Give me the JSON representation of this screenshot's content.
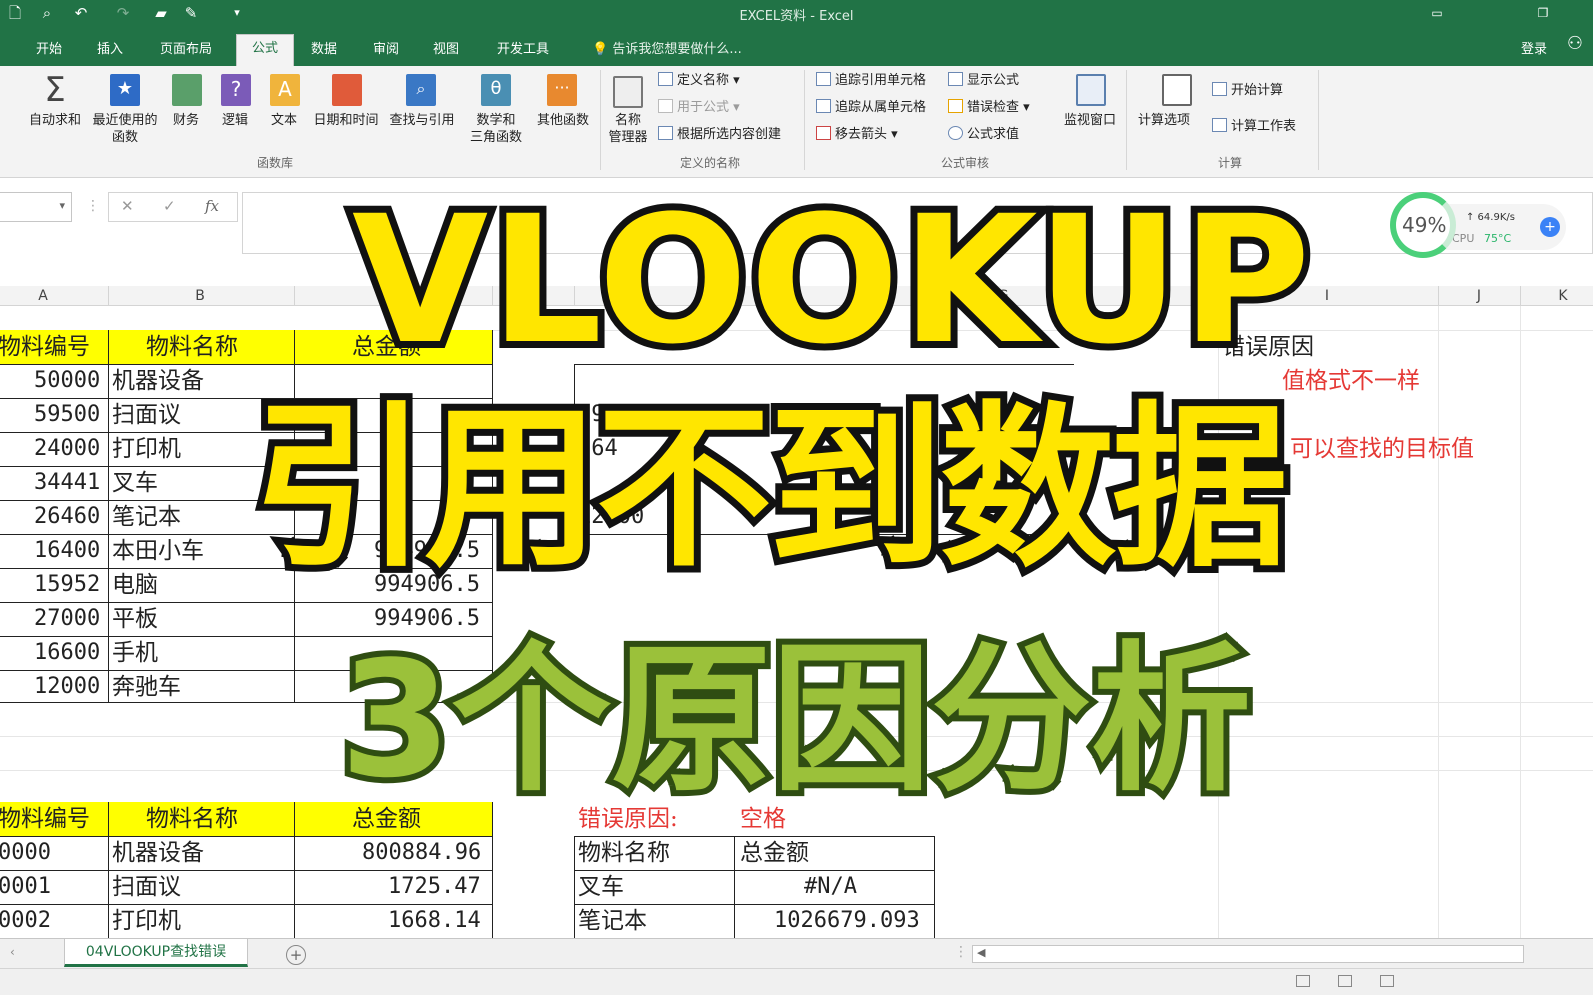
{
  "window": {
    "title": "EXCEL资料 - Excel"
  },
  "tabs": [
    "开始",
    "插入",
    "页面布局",
    "公式",
    "数据",
    "审阅",
    "视图",
    "开发工具"
  ],
  "active_tab": "公式",
  "tell_me": "告诉我您想要做什么...",
  "account": {
    "login": "登录"
  },
  "ribbon": {
    "funclib": {
      "items": [
        "自动求和",
        "最近使用的",
        "函数",
        "财务",
        "逻辑",
        "文本",
        "日期和时间",
        "查找与引用",
        "数学和",
        "三角函数",
        "其他函数"
      ],
      "group": "函数库"
    },
    "names": {
      "manager_line1": "名称",
      "manager_line2": "管理器",
      "define": "定义名称",
      "use_in_formula": "用于公式",
      "create": "根据所选内容创建",
      "group": "定义的名称"
    },
    "audit": {
      "trace_prec": "追踪引用单元格",
      "trace_dep": "追踪从属单元格",
      "remove_arrows": "移去箭头",
      "show_formulas": "显示公式",
      "error_check": "错误检查",
      "evaluate": "公式求值",
      "watch": "监视窗口",
      "group": "公式审核"
    },
    "calc": {
      "options": "计算选项",
      "calc_now": "开始计算",
      "calc_sheet": "计算工作表",
      "group": "计算"
    }
  },
  "formula_bar": {
    "cancel": "✕",
    "enter": "✓",
    "fx": "fx"
  },
  "cpu_widget": {
    "percent": "49%",
    "net": "↑ 64.9K/s",
    "cpu_label": "CPU",
    "temp": "75°C"
  },
  "columns": [
    "A",
    "B",
    "D",
    "G",
    "I",
    "J",
    "K"
  ],
  "table1": {
    "headers": [
      "物料编号",
      "物料名称",
      "总金额"
    ],
    "rows": [
      {
        "id": "50000",
        "name": "机器设备"
      },
      {
        "id": "59500",
        "name": "扫面议"
      },
      {
        "id": "24000",
        "name": "打印机"
      },
      {
        "id": "34441",
        "name": "叉车"
      },
      {
        "id": "26460",
        "name": "笔记本"
      },
      {
        "id": "16400",
        "name": "本田小车",
        "amount": "994906.5"
      },
      {
        "id": "15952",
        "name": "电脑",
        "amount": "994906.5"
      },
      {
        "id": "27000",
        "name": "平板",
        "amount": "994906.5"
      },
      {
        "id": "16600",
        "name": "手机"
      },
      {
        "id": "12000",
        "name": "奔驰车"
      }
    ]
  },
  "lookup1": {
    "partial": [
      "59500",
      "264",
      "12000"
    ]
  },
  "right_notes": {
    "header": "错误原因",
    "note1": "值格式不一样",
    "note2": "可以查找的目标值"
  },
  "table2": {
    "headers": [
      "物料编号",
      "物料名称",
      "总金额"
    ],
    "rows": [
      {
        "id": "0000",
        "name": "机器设备",
        "amount": "800884.96"
      },
      {
        "id": "0001",
        "name": "扫面议",
        "amount": "1725.47"
      },
      {
        "id": "0002",
        "name": "打印机",
        "amount": "1668.14"
      }
    ]
  },
  "lookup2": {
    "label": "错误原因:",
    "reason": "空格",
    "headers": [
      "物料名称",
      "总金额"
    ],
    "rows": [
      {
        "name": "叉车",
        "value": "#N/A"
      },
      {
        "name": "笔记本",
        "value": "1026679.093"
      }
    ]
  },
  "sheet_tab": "04VLOOKUP查找错误",
  "overlay": {
    "line1": "VLOOKUP",
    "line2": "引用不到数据",
    "line3": "3个原因分析"
  }
}
